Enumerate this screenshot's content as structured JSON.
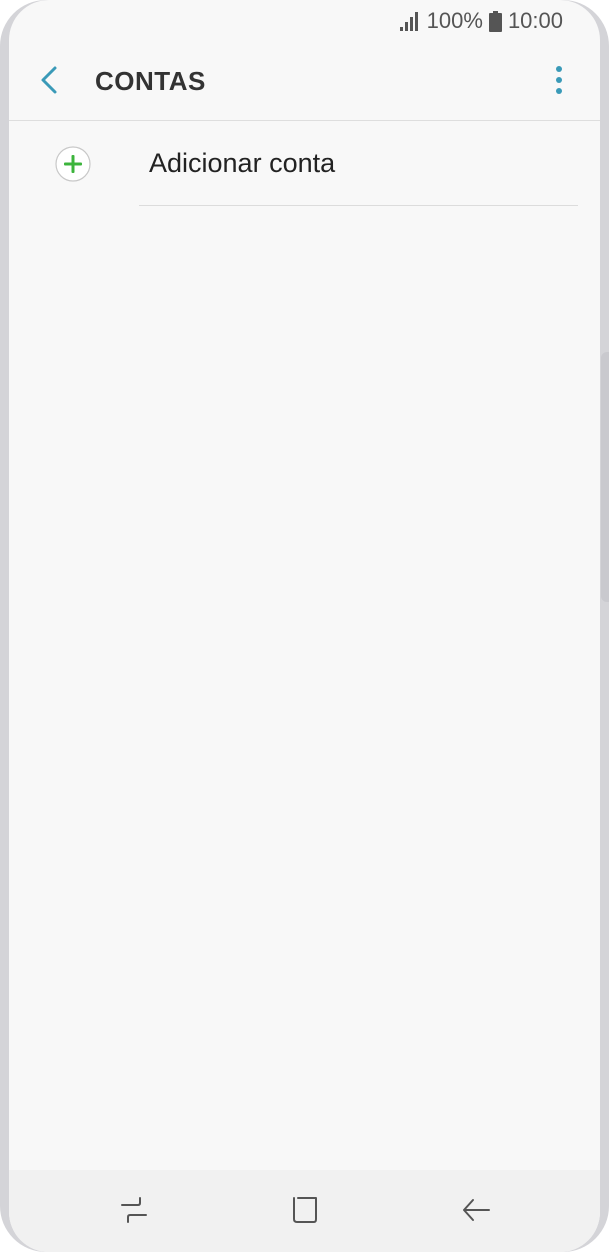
{
  "status_bar": {
    "battery": "100%",
    "time": "10:00",
    "signal_icon": "signal-icon",
    "battery_icon": "battery-icon"
  },
  "app_bar": {
    "title": "CONTAS",
    "back_icon": "chevron-left-icon",
    "more_icon": "more-vertical-icon",
    "accent_color": "#3a9ab8"
  },
  "accounts_list": {
    "items": [
      {
        "label": "Adicionar conta",
        "icon": "plus-circle-icon",
        "icon_color": "#3cb43c"
      }
    ]
  },
  "nav_bar": {
    "recent_icon": "recent-apps-icon",
    "home_icon": "home-icon",
    "back_icon": "back-arrow-icon"
  }
}
